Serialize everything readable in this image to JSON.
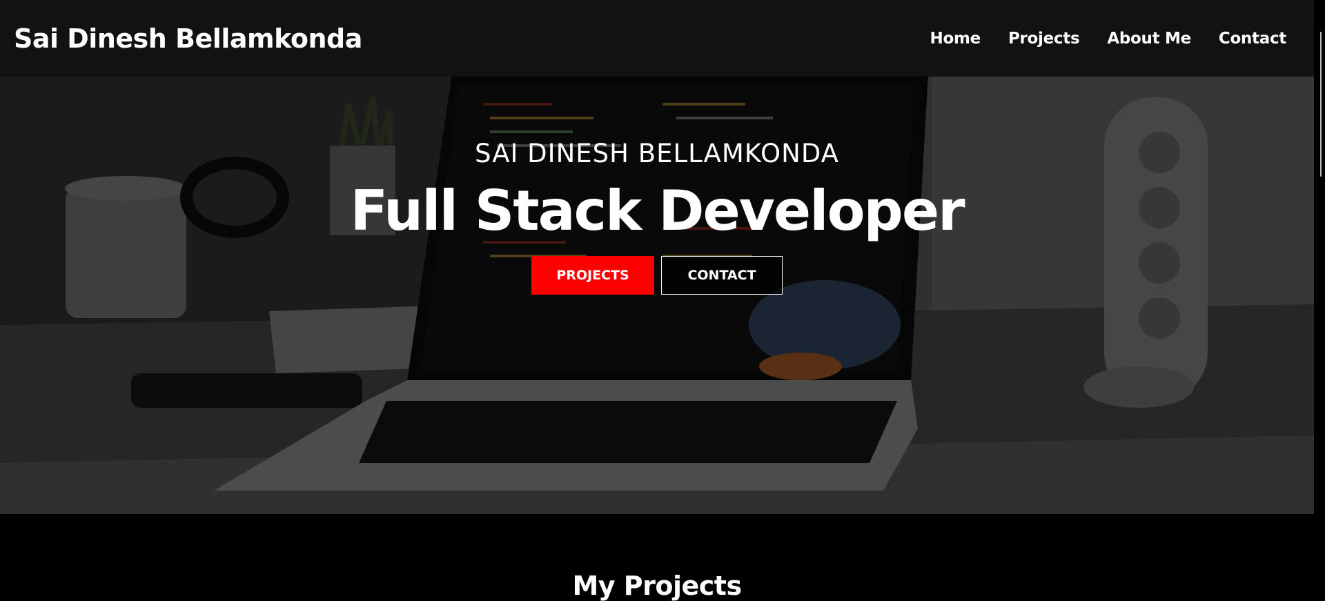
{
  "navbar": {
    "brand": "Sai Dinesh Bellamkonda",
    "links": [
      "Home",
      "Projects",
      "About Me",
      "Contact"
    ]
  },
  "hero": {
    "name": "SAI DINESH BELLAMKONDA",
    "title": "Full Stack Developer",
    "buttons": {
      "projects": "PROJECTS",
      "contact": "CONTACT"
    }
  },
  "projects": {
    "heading": "My Projects"
  },
  "colors": {
    "accent": "#ff0000",
    "navbar_bg": "#121212",
    "page_bg": "#000000"
  }
}
